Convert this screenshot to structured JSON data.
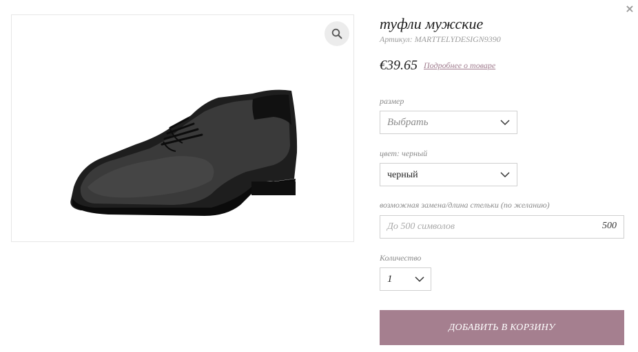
{
  "product": {
    "title": "туфли мужские",
    "sku_label": "Артикул:",
    "sku_value": "MARTTELYDESIGN9390",
    "price": "€39.65",
    "details_link": "Подробнее о товаре",
    "image_icon": "dress-shoe-photo"
  },
  "icons": {
    "close": "close-icon",
    "zoom": "magnifier-icon",
    "chevron": "chevron-down-icon"
  },
  "size": {
    "label": "размер",
    "value": "Выбрать"
  },
  "color": {
    "label": "цвет: черный",
    "value": "черный"
  },
  "insole": {
    "label": "возможная замена/длина стельки (по желанию)",
    "placeholder": "До 500 символов",
    "counter": "500"
  },
  "quantity": {
    "label": "Количество",
    "value": "1"
  },
  "cart_button": {
    "label": "ДОБАВИТЬ В КОРЗИНУ"
  },
  "colors": {
    "accent": "#a57f8f",
    "link": "#a07c8e",
    "border": "#cfcfcf"
  }
}
